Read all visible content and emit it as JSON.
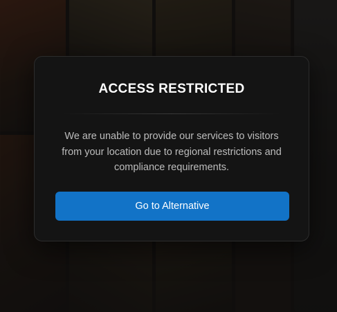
{
  "modal": {
    "title": "ACCESS RESTRICTED",
    "message": "We are unable to provide our services to visitors from your location due to regional restrictions and compliance requirements.",
    "button_label": "Go to Alternative"
  },
  "colors": {
    "modal_background": "#141414",
    "button_background": "#1273c7",
    "title_text": "#ffffff",
    "message_text": "#bdbdbd"
  }
}
